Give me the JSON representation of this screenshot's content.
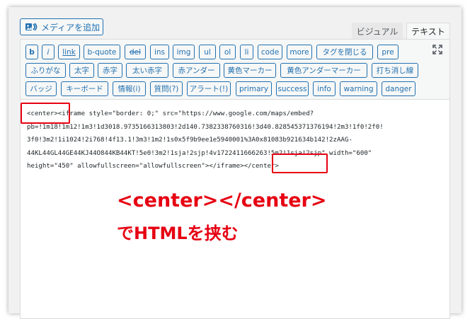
{
  "media_button": {
    "label": "メディアを追加",
    "icon": "media-icon"
  },
  "tabs": [
    {
      "label": "ビジュアル",
      "active": false
    },
    {
      "label": "テキスト",
      "active": true
    }
  ],
  "toolbar": {
    "row1": [
      "b",
      "i",
      "link",
      "b-quote",
      "del",
      "ins",
      "img",
      "ul",
      "ol",
      "li",
      "code",
      "more",
      "タグを閉じる",
      "pre"
    ],
    "row2": [
      "ふりがな",
      "太字",
      "赤字",
      "太い赤字",
      "赤アンダー",
      "黄色マーカー",
      "黄色アンダーマーカー",
      "打ち消し線"
    ],
    "row3": [
      "バッジ",
      "キーボード",
      "情報(i)",
      "質問(?)",
      "アラート(!)",
      "primary",
      "success",
      "info",
      "warning",
      "danger"
    ],
    "fullscreen_icon": "fullscreen-icon"
  },
  "editor": {
    "lines": [
      "<center><iframe style=\"border: 0;\" src=\"https://www.google.com/maps/embed?",
      "pb=!1m18!1m12!1m3!1d3018.9735166313803!2d140.7382338760316!3d40.828545371376194!2m3!1f0!2f0!",
      "3f0!3m2!1i1024!2i768!4f13.1!3m3!1m2!1s0x5f9b9ee1e5940001%3A0x81083b921634b142!2zAAG-",
      "44KL44GL44GE44KJ44O844KB44KT!5e0!3m2!1sja!2sjp!4v1722411666263!5m2!1sja!2sjp\" width=\"600\"",
      "height=\"450\" allowfullscreen=\"allowfullscreen\"></iframe></center>"
    ]
  },
  "annotation": {
    "line1": "<center></center>",
    "line2": "でHTMLを挟む",
    "color": "#e60012"
  },
  "colors": {
    "accent": "#2271b1",
    "highlight": "#e60012"
  }
}
